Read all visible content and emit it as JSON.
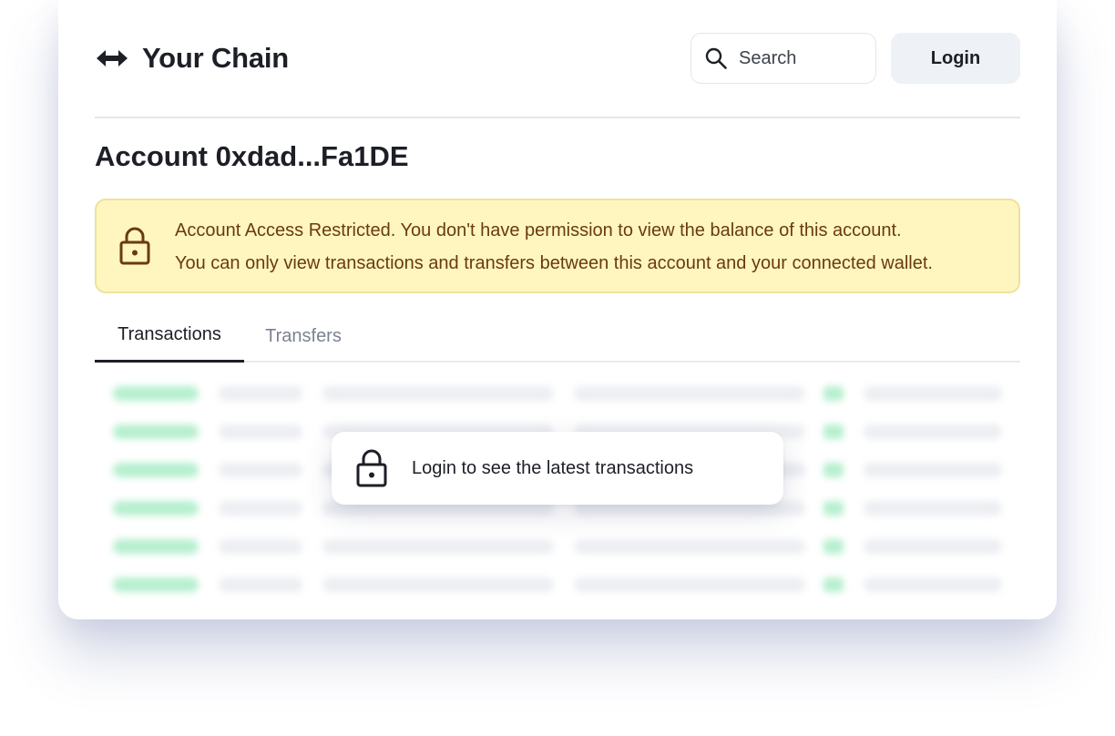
{
  "header": {
    "brand_name": "Your Chain",
    "brand_icon": "arrows-left-right-icon",
    "search_placeholder": "Search",
    "login_label": "Login"
  },
  "page": {
    "title": "Account 0xdad...Fa1DE"
  },
  "alert": {
    "icon": "lock-icon",
    "line1": "Account Access Restricted. You don't have permission to view the balance of this account.",
    "line2": "You can only view transactions and transfers between this account and your connected wallet."
  },
  "tabs": [
    {
      "label": "Transactions",
      "active": true
    },
    {
      "label": "Transfers",
      "active": false
    }
  ],
  "overlay": {
    "icon": "lock-icon",
    "message": "Login to see the latest transactions"
  },
  "colors": {
    "alert_background": "#fff6bf",
    "alert_text": "#6a3a10",
    "status_green": "#b6efcf",
    "text_primary": "#1d1f27",
    "tab_inactive": "#7b8290"
  }
}
